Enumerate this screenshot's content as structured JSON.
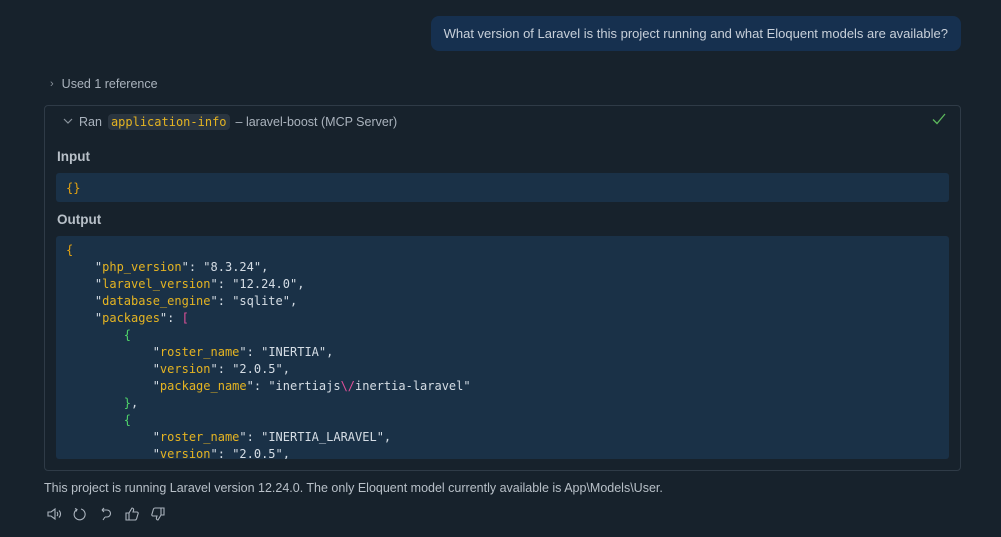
{
  "user_message": "What version of Laravel is this project running and what Eloquent models are available?",
  "references": {
    "label": "Used 1 reference"
  },
  "tool_call": {
    "prefix": "Ran",
    "tool_name": "application-info",
    "suffix": "– laravel-boost (MCP Server)",
    "status": "success",
    "input_label": "Input",
    "input_value": "{}",
    "output_label": "Output",
    "output_lines": [
      [
        [
          "brace0",
          "{"
        ]
      ],
      [
        [
          "punc",
          "    \""
        ],
        [
          "key",
          "php_version"
        ],
        [
          "punc",
          "\": "
        ],
        [
          "str",
          "\"8.3.24\""
        ],
        [
          "punc",
          ","
        ]
      ],
      [
        [
          "punc",
          "    \""
        ],
        [
          "key",
          "laravel_version"
        ],
        [
          "punc",
          "\": "
        ],
        [
          "str",
          "\"12.24.0\""
        ],
        [
          "punc",
          ","
        ]
      ],
      [
        [
          "punc",
          "    \""
        ],
        [
          "key",
          "database_engine"
        ],
        [
          "punc",
          "\": "
        ],
        [
          "str",
          "\"sqlite\""
        ],
        [
          "punc",
          ","
        ]
      ],
      [
        [
          "punc",
          "    \""
        ],
        [
          "key",
          "packages"
        ],
        [
          "punc",
          "\": "
        ],
        [
          "bracket",
          "["
        ]
      ],
      [
        [
          "brace1",
          "        {"
        ]
      ],
      [
        [
          "punc",
          "            \""
        ],
        [
          "key",
          "roster_name"
        ],
        [
          "punc",
          "\": "
        ],
        [
          "str",
          "\"INERTIA\""
        ],
        [
          "punc",
          ","
        ]
      ],
      [
        [
          "punc",
          "            \""
        ],
        [
          "key",
          "version"
        ],
        [
          "punc",
          "\": "
        ],
        [
          "str",
          "\"2.0.5\""
        ],
        [
          "punc",
          ","
        ]
      ],
      [
        [
          "punc",
          "            \""
        ],
        [
          "key",
          "package_name"
        ],
        [
          "punc",
          "\": "
        ],
        [
          "str",
          "\"inertiajs"
        ],
        [
          "esc",
          "\\/"
        ],
        [
          "str",
          "inertia-laravel\""
        ]
      ],
      [
        [
          "brace1",
          "        }"
        ],
        [
          "punc",
          ","
        ]
      ],
      [
        [
          "brace1",
          "        {"
        ]
      ],
      [
        [
          "punc",
          "            \""
        ],
        [
          "key",
          "roster_name"
        ],
        [
          "punc",
          "\": "
        ],
        [
          "str",
          "\"INERTIA_LARAVEL\""
        ],
        [
          "punc",
          ","
        ]
      ],
      [
        [
          "punc",
          "            \""
        ],
        [
          "key",
          "version"
        ],
        [
          "punc",
          "\": "
        ],
        [
          "str",
          "\"2.0.5\""
        ],
        [
          "punc",
          ","
        ]
      ]
    ]
  },
  "answer": "This project is running Laravel version 12.24.0. The only Eloquent model currently available is App\\Models\\User.",
  "actions": [
    "read-aloud",
    "retry",
    "undo",
    "thumbs-up",
    "thumbs-down"
  ]
}
